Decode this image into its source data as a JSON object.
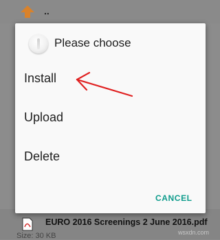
{
  "background": {
    "parent_label": "..",
    "file_name": "EURO 2016 Screenings 2 June 2016.pdf",
    "file_size": "Size: 30 KB"
  },
  "dialog": {
    "title": "Please choose",
    "options": [
      {
        "label": "Install"
      },
      {
        "label": "Upload"
      },
      {
        "label": "Delete"
      }
    ],
    "cancel_label": "CANCEL"
  },
  "annotation": {
    "arrow_color": "#e02020"
  },
  "watermark": "wsxdn.com",
  "colors": {
    "accent": "#0e9c8c",
    "folder_arrow": "#d9822b"
  },
  "icons": {
    "up": "up-arrow-icon",
    "pdf": "pdf-file-icon",
    "app": "app-icon"
  }
}
